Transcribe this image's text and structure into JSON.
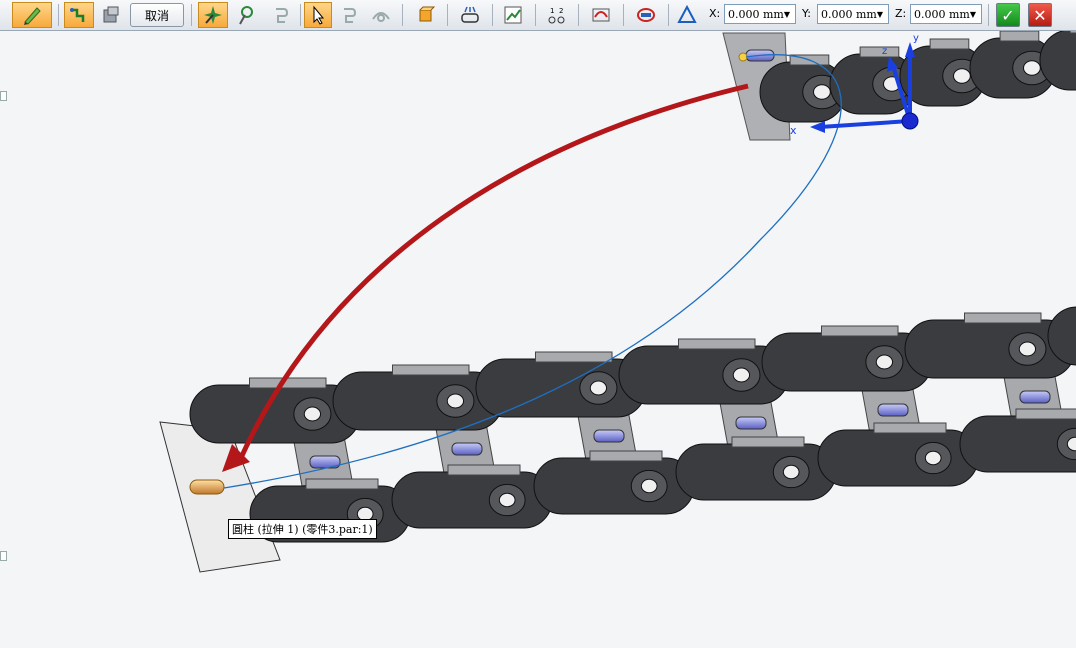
{
  "toolbar": {
    "cancel_label": "取消",
    "x_label": "X:",
    "y_label": "Y:",
    "z_label": "Z:",
    "x_value": "0.000 mm",
    "y_value": "0.000 mm",
    "z_value": "0.000 mm",
    "icons": [
      "pencil-icon",
      "step-icon",
      "part-icon",
      "smart-select-icon",
      "select-pick-icon",
      "undo-step-icon",
      "arrow-select-icon",
      "redo-step-icon",
      "view-rotate-icon",
      "face-icon",
      "relationship-icon",
      "graph-icon",
      "align-icon",
      "curve-icon",
      "rotate-path-icon",
      "triangle-icon",
      "accept-icon",
      "cancel-icon"
    ]
  },
  "tooltip": {
    "text": "圓柱 (拉伸 1) (零件3.par:1)"
  },
  "colors": {
    "arrow": "#b3171a",
    "path": "#1f6fc0",
    "link": "#3a3c40",
    "pin": "#7b7fd6",
    "triad": "#1a3fe0",
    "highlight": "#f0a641"
  }
}
